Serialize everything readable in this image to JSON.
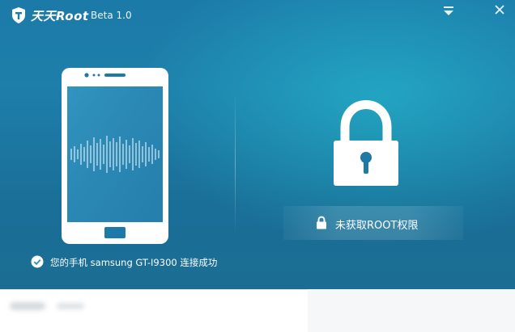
{
  "titlebar": {
    "brand": "天天Root",
    "version": "Beta 1.0",
    "menu_icon": "menu-dropdown-icon",
    "close_icon": "close-icon"
  },
  "phone": {
    "icon": "smartphone-icon",
    "screen_icon": "signal-waveform-icon"
  },
  "lock": {
    "icon": "padlock-icon",
    "status_icon": "small-padlock-icon",
    "status_text": "未获取ROOT权限"
  },
  "connection": {
    "icon": "check-circle-icon",
    "text": "您的手机 samsung GT-I9300 连接成功"
  },
  "colors": {
    "background_top": "#1c7aa9",
    "background_glow": "#26c4d6",
    "check_blue": "#2a8fc9",
    "white": "#ffffff"
  }
}
